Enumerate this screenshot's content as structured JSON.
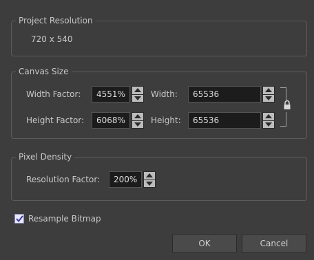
{
  "project_resolution": {
    "title": "Project Resolution",
    "value": "720 x 540"
  },
  "canvas_size": {
    "title": "Canvas Size",
    "width_factor_label": "Width Factor:",
    "width_factor_value": "4551%",
    "height_factor_label": "Height Factor:",
    "height_factor_value": "6068%",
    "width_label": "Width:",
    "width_value": "65536",
    "height_label": "Height:",
    "height_value": "65536",
    "icons": {
      "aspect_lock": "lock-icon"
    }
  },
  "pixel_density": {
    "title": "Pixel Density",
    "resolution_factor_label": "Resolution Factor:",
    "resolution_factor_value": "200%"
  },
  "resample_bitmap": {
    "label": "Resample Bitmap",
    "checked": true
  },
  "buttons": {
    "ok": "OK",
    "cancel": "Cancel"
  },
  "colors": {
    "background": "#3d3d3d",
    "field_background": "#1c1c1c",
    "text": "#c8c8c8",
    "checkbox_accent": "#3a3aa0"
  }
}
